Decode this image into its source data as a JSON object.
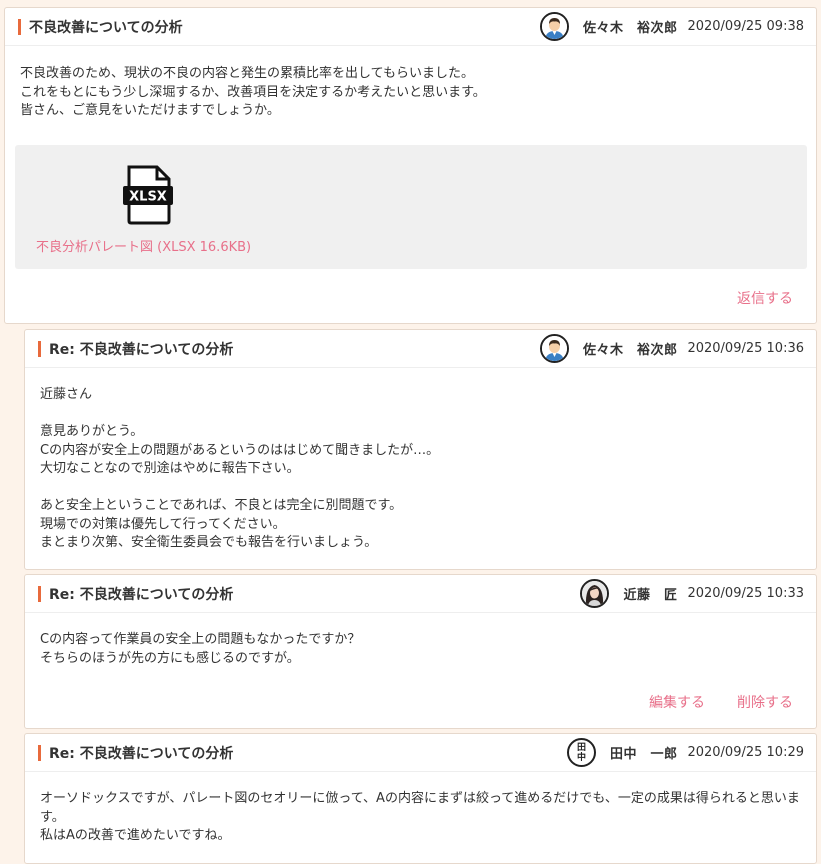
{
  "posts": [
    {
      "title": "不良改善についての分析",
      "author": "佐々木　裕次郎",
      "date": "2020/09/25 09:38",
      "avatar": "male-avatar-icon",
      "body": "不良改善のため、現状の不良の内容と発生の累積比率を出してもらいました。\nこれをもとにもう少し深堀するか、改善項目を決定するか考えたいと思います。\n皆さん、ご意見をいただけますでしょうか。",
      "attachment": {
        "icon": "xlsx-file-icon",
        "label": "不良分析パレート図 (XLSX 16.6KB)"
      },
      "reply_label": "返信する"
    },
    {
      "title": "Re: 不良改善についての分析",
      "author": "佐々木　裕次郎",
      "date": "2020/09/25 10:36",
      "avatar": "male-avatar-icon",
      "body": "近藤さん\n\n意見ありがとう。\nCの内容が安全上の問題があるというのははじめて聞きましたが…。\n大切なことなので別途はやめに報告下さい。\n\nあと安全上ということであれば、不良とは完全に別問題です。\n現場での対策は優先して行ってください。\nまとまり次第、安全衛生委員会でも報告を行いましょう。"
    },
    {
      "title": "Re: 不良改善についての分析",
      "author": "近藤　匠",
      "date": "2020/09/25 10:33",
      "avatar": "female-avatar-icon",
      "body": "Cの内容って作業員の安全上の問題もなかったですか？\nそちらのほうが先の方にも感じるのですが。",
      "edit_label": "編集する",
      "delete_label": "削除する"
    },
    {
      "title": "Re: 不良改善についての分析",
      "author": "田中　一郎",
      "date": "2020/09/25 10:29",
      "avatar_text": [
        "田",
        "中"
      ],
      "body": "オーソドックスですが、パレート図のセオリーに倣って、Aの内容にまずは絞って進めるだけでも、一定の成果は得られると思います。\n私はAの改善で進めたいですね。"
    }
  ],
  "colors": {
    "accent": "#e86a3c",
    "link": "#e8708a",
    "page_bg": "#fdf3ea"
  }
}
